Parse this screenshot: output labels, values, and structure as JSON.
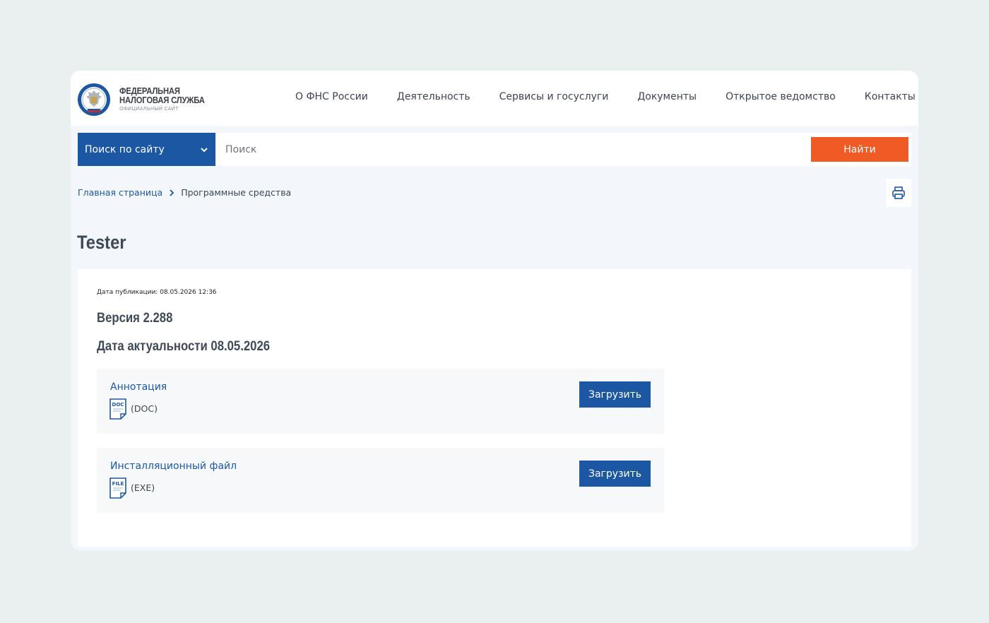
{
  "header": {
    "logo": {
      "line1": "ФЕДЕРАЛЬНАЯ",
      "line2": "НАЛОГОВАЯ СЛУЖБА",
      "line3": "ОФИЦИАЛЬНЫЙ САЙТ",
      "emblem_icon": "fns-emblem-icon"
    },
    "nav": [
      "О ФНС России",
      "Деятельность",
      "Сервисы и госуслуги",
      "Документы",
      "Открытое ведомство",
      "Контакты"
    ]
  },
  "search": {
    "scope_label": "Поиск по сайту",
    "scope_icon": "chevron-down-icon",
    "value": "",
    "placeholder": "Поиск",
    "button_label": "Найти"
  },
  "breadcrumb": {
    "home": "Главная страница",
    "separator_icon": "chevron-right-icon",
    "current": "Программные средства"
  },
  "print_icon": "printer-icon",
  "page": {
    "title": "Tester",
    "publication_date": "Дата публикации: 08.05.2026 12:36",
    "version": "Версия 2.288",
    "actuality_date": "Дата актуальности 08.05.2026",
    "files": [
      {
        "name": "Аннотация",
        "type": "(DOC)",
        "icon_label": "DOC",
        "icon": "doc-file-icon",
        "button_label": "Загрузить"
      },
      {
        "name": "Инсталляционный файл",
        "type": "(EXE)",
        "icon_label": "FILE",
        "icon": "file-icon",
        "button_label": "Загрузить"
      }
    ]
  },
  "colors": {
    "primary_blue": "#1b57a3",
    "accent_orange": "#ef5a25",
    "outer_background": "#e9f0ef",
    "page_background": "#f3f7fc"
  }
}
